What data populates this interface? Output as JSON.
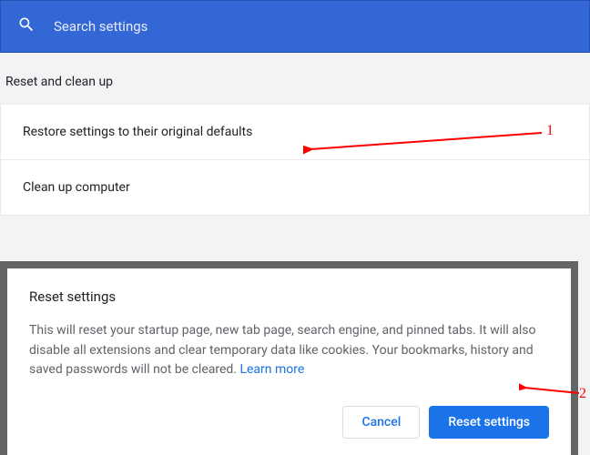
{
  "search": {
    "placeholder": "Search settings"
  },
  "section": {
    "title": "Reset and clean up"
  },
  "rows": {
    "restore": "Restore settings to their original defaults",
    "cleanup": "Clean up computer"
  },
  "dialog": {
    "title": "Reset settings",
    "body": "This will reset your startup page, new tab page, search engine, and pinned tabs. It will also disable all extensions and clear temporary data like cookies. Your bookmarks, history and saved passwords will not be cleared. ",
    "learn_more": "Learn more",
    "actions": {
      "cancel": "Cancel",
      "confirm": "Reset settings"
    }
  },
  "annotations": {
    "one": "1",
    "two": "2"
  }
}
